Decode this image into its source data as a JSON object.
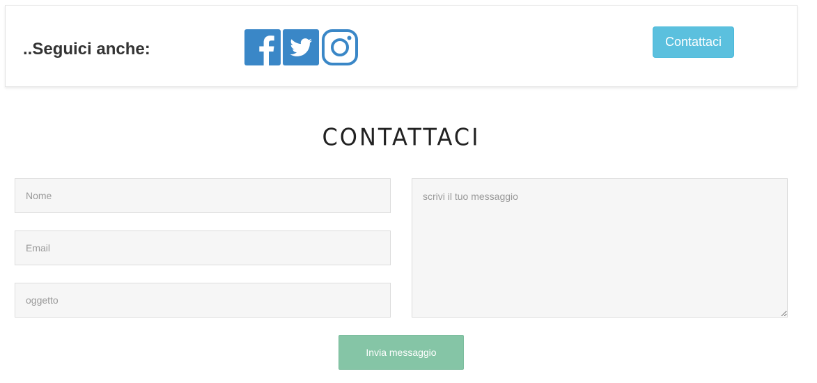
{
  "follow": {
    "label": "..Seguici anche:",
    "social": [
      {
        "icon": "facebook-icon",
        "color": "#3a87c7"
      },
      {
        "icon": "twitter-icon",
        "color": "#3a87c7"
      },
      {
        "icon": "instagram-icon",
        "color": "#3a87c7"
      }
    ],
    "contact_button": "Contattaci"
  },
  "contact": {
    "title": "CONTATTACI",
    "name_placeholder": "Nome",
    "email_placeholder": "Email",
    "subject_placeholder": "oggetto",
    "message_placeholder": "scrivi il tuo messaggio",
    "send_button": "Invia messaggio"
  },
  "colors": {
    "info_button": "#5bc0de",
    "send_button": "#85c5a6",
    "social_icon": "#3a87c7"
  }
}
